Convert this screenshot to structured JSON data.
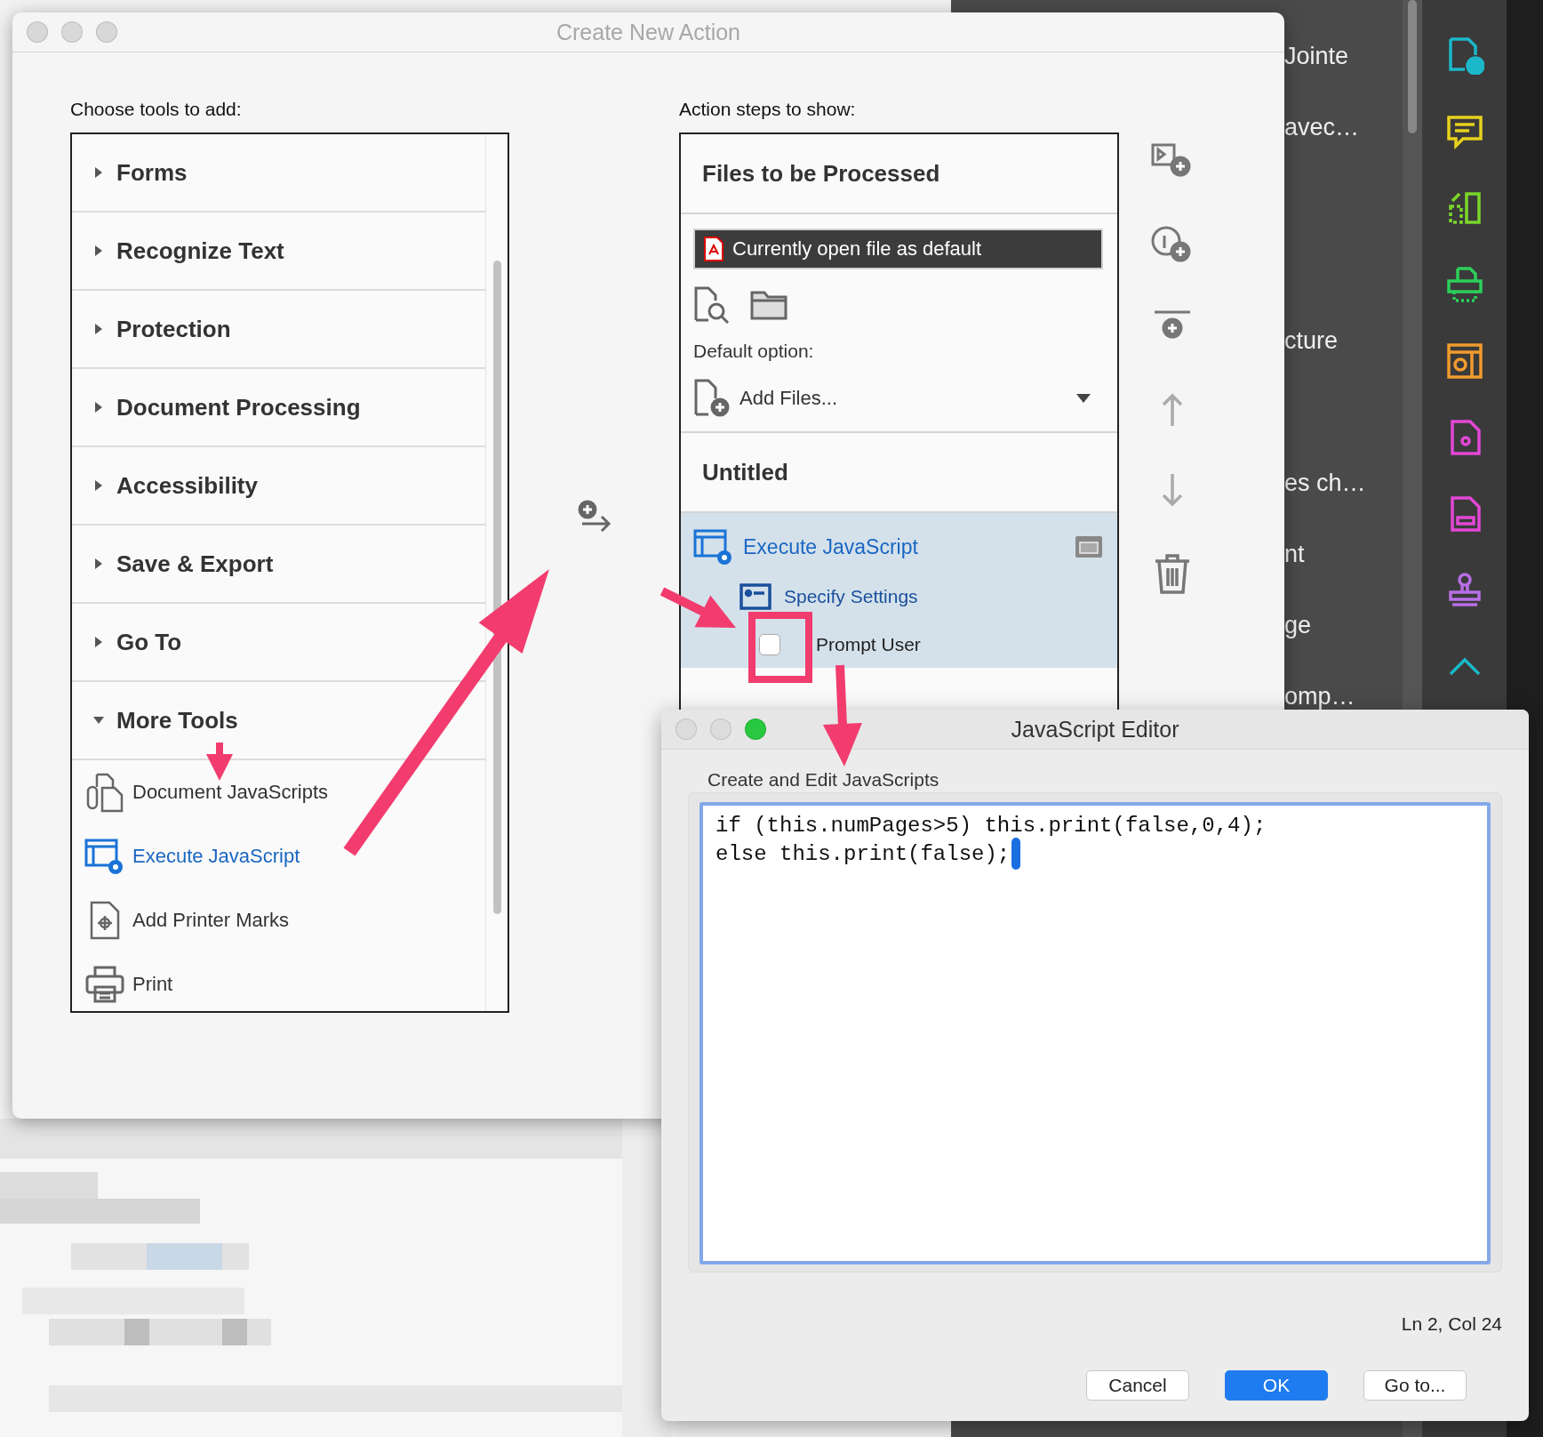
{
  "background_app": {
    "labels": [
      "Jointe",
      "avec…",
      "cture",
      "es ch…",
      "nt",
      "ge",
      "omp…"
    ]
  },
  "create_action": {
    "title": "Create New Action",
    "tools_heading": "Choose tools to add:",
    "tool_groups": [
      {
        "label": "Forms",
        "expanded": false
      },
      {
        "label": "Recognize Text",
        "expanded": false
      },
      {
        "label": "Protection",
        "expanded": false
      },
      {
        "label": "Document Processing",
        "expanded": false
      },
      {
        "label": "Accessibility",
        "expanded": false
      },
      {
        "label": "Save & Export",
        "expanded": false
      },
      {
        "label": "Go To",
        "expanded": false
      },
      {
        "label": "More Tools",
        "expanded": true,
        "children": [
          {
            "kind": "scripts",
            "label": "Document JavaScripts",
            "selected": false
          },
          {
            "kind": "execute",
            "label": "Execute JavaScript",
            "selected": true
          },
          {
            "kind": "marks",
            "label": "Add Printer Marks",
            "selected": false
          },
          {
            "kind": "print",
            "label": "Print",
            "selected": false
          }
        ]
      }
    ],
    "steps_heading": "Action steps to show:",
    "files_section": {
      "title": "Files to be Processed",
      "source": "Currently open file as default",
      "default_option_label": "Default option:",
      "default_option": "Add Files..."
    },
    "action_section": {
      "title": "Untitled",
      "step": "Execute JavaScript",
      "setting": "Specify Settings",
      "prompt_user": {
        "label": "Prompt User",
        "checked": false
      }
    }
  },
  "editor": {
    "title": "JavaScript Editor",
    "group_label": "Create and Edit JavaScripts",
    "code": [
      "if (this.numPages>5) this.print(false,0,4);",
      "else this.print(false);"
    ],
    "position": "Ln 2, Col 24",
    "buttons": [
      {
        "label": "Cancel",
        "default": false
      },
      {
        "label": "OK",
        "default": true
      },
      {
        "label": "Go to...",
        "default": false
      }
    ]
  }
}
